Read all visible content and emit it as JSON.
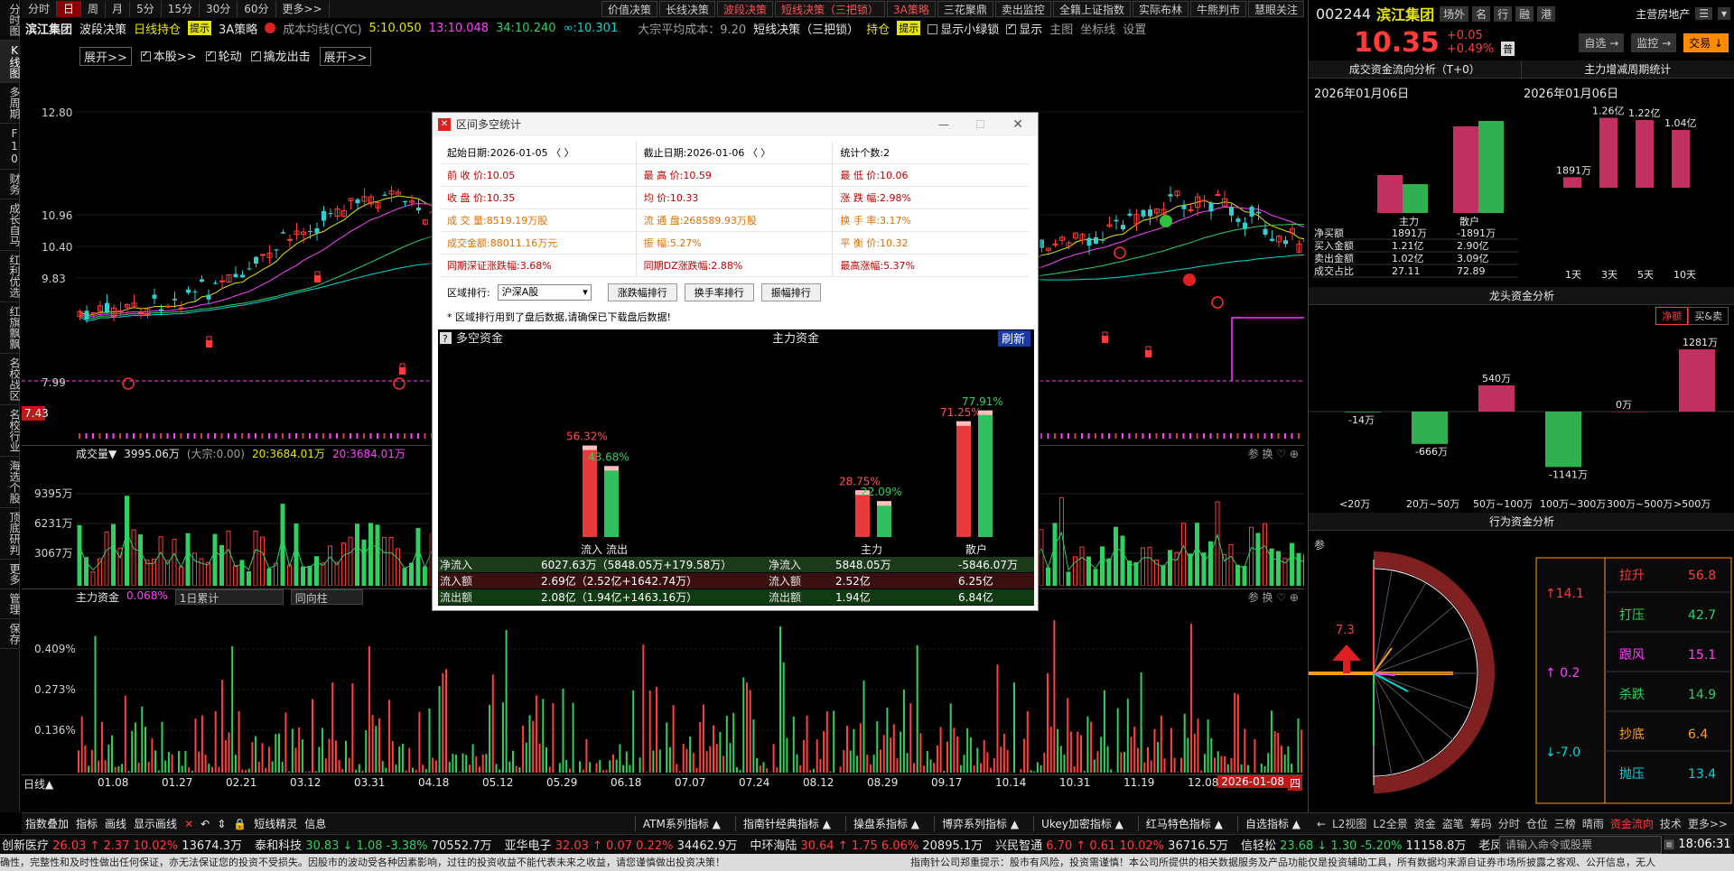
{
  "sidebar": [
    "分时图",
    "K线图",
    "多周期",
    "F10",
    "财务",
    "成长自马",
    "红利优选",
    "红旗飘飘",
    "名校战区",
    "名校行业",
    "海选个股",
    "顶底研判",
    "更多",
    "管理",
    "保存"
  ],
  "periods": [
    "分时",
    "日",
    "周",
    "月",
    "5分",
    "15分",
    "30分",
    "60分",
    "更多>>"
  ],
  "toolbar": [
    "价值决策",
    "长线决策",
    "波段决策",
    "短线决策（三把锁）",
    "3A策略",
    "三花聚鼎",
    "卖出监控",
    "全籍上证指数",
    "实际布林",
    "牛熊判市",
    "慧眼关注"
  ],
  "info": {
    "name": "滨江集团",
    "tag1": "波段决策",
    "tag2": "日线持仓",
    "tip": "提示",
    "strat": "3A策略",
    "cyc_label": "成本均线(CYC)",
    "cyc1": "5:10.050",
    "cyc2": "13:10.048",
    "cyc3": "34:10.240",
    "cyc4": "∞:10.301",
    "avg_cost": "大宗平均成本：9.20",
    "short": "短线决策（三把锁）",
    "hold": "持仓",
    "tip2": "提示",
    "show_green": "显示小绿锁",
    "show_more": "显示",
    "main_chart": "主图",
    "coord": "坐标线",
    "settings": "设置"
  },
  "sub": {
    "expand1": "展开>>",
    "this": "本股>>",
    "rotate": "轮动",
    "catch": "擒龙出击",
    "expand2": "展开>>"
  },
  "price_axis": {
    "p1": "12.80",
    "p2": "10.96",
    "p3": "10.40",
    "p4": "9.83",
    "p5": "7.99",
    "low": "7.43"
  },
  "vol": {
    "label": "成交量▼",
    "v": "3995.06万",
    "dz": "(大宗:0.00)",
    "ma20": "20:3684.01万",
    "ma20b": "20:3684.01万",
    "a1": "9395万",
    "a2": "6231万",
    "a3": "3067万"
  },
  "fund": {
    "label": "主力资金",
    "pct": "0.068%",
    "sel1": "1日累计",
    "sel2": "同向柱",
    "a1": "0.409%",
    "a2": "0.273%",
    "a3": "0.136%"
  },
  "panel_icons": "参 换 ♡ ⊕",
  "xaxis": {
    "label": "日线▲",
    "dates": [
      "01.08",
      "01.27",
      "02.21",
      "03.12",
      "03.31",
      "04.18",
      "05.12",
      "05.29",
      "06.18",
      "07.07",
      "07.24",
      "08.12",
      "08.29",
      "09.17",
      "10.14",
      "10.31",
      "11.19",
      "12.08"
    ],
    "cur": "2026-01-08",
    "cur_tag": "四"
  },
  "right": {
    "code": "002244",
    "name": "滨江集团",
    "tabs": [
      "场外",
      "名",
      "行",
      "融",
      "港"
    ],
    "sector": "主营房地产",
    "price": "10.35",
    "chg": "+0.05",
    "chgp": "+0.49%",
    "badge": "普",
    "btn_self": "自选 →",
    "btn_mon": "监控 →",
    "btn_trade": "交易 ↓",
    "flow_title": "成交资金流向分析（T+0）",
    "cycle_title": "主力增减周期统计",
    "date": "2026年01月06日",
    "flow_bars": {
      "main_label": "主力",
      "retail_label": "散户"
    },
    "flow_table": [
      [
        "净买额",
        "1891万",
        "-1891万"
      ],
      [
        "买入金额",
        "1.21亿",
        "2.90亿"
      ],
      [
        "卖出金额",
        "1.02亿",
        "3.09亿"
      ],
      [
        "成交占比",
        "27.11",
        "72.89"
      ]
    ],
    "cycle": {
      "labels": [
        "1天",
        "3天",
        "5天",
        "10天"
      ],
      "values": [
        "1891万",
        "1.26亿",
        "1.22亿",
        "1.04亿"
      ],
      "num": [
        0.19,
        1.26,
        1.22,
        1.04
      ]
    },
    "dragon_title": "龙头资金分析",
    "dragon_tabs": [
      "净额",
      "买&卖"
    ],
    "dragon": {
      "labels": [
        "<20万",
        "20万~50万",
        "50万~100万",
        "100万~300万",
        "300万~500万",
        ">500万"
      ],
      "values": [
        "-14万",
        "-666万",
        "540万",
        "-1141万",
        "0万",
        "1281万"
      ],
      "num": [
        -14,
        -666,
        540,
        -1141,
        0,
        1281
      ]
    },
    "behav_title": "行为资金分析",
    "behav_side": "参",
    "behav_arrow": "7.3",
    "behav_left": [
      {
        "v": "↑14.1",
        "c": "#ff3c3c"
      },
      {
        "v": "↑ 0.2",
        "c": "#ff40ff"
      },
      {
        "v": "↓-7.0",
        "c": "#00d8d8"
      }
    ],
    "behav_right": [
      {
        "k": "拉升",
        "v": "56.8",
        "c": "#ff3c3c"
      },
      {
        "k": "打压",
        "v": "42.7",
        "c": "#30d060"
      },
      {
        "k": "跟风",
        "v": "15.1",
        "c": "#ff40ff"
      },
      {
        "k": "杀跌",
        "v": "14.9",
        "c": "#30d060"
      },
      {
        "k": "抄底",
        "v": "6.4",
        "c": "#ff9a20"
      },
      {
        "k": "抛压",
        "v": "13.4",
        "c": "#00d8d8"
      }
    ],
    "bottom_tabs": [
      "←",
      "L2视图",
      "L2全景",
      "资金",
      "盗笔",
      "筹码",
      "分时",
      "仓位",
      "三榜",
      "晴雨",
      "资金流向",
      "技术",
      "更多>>"
    ]
  },
  "dialog": {
    "title": "区间多空统计",
    "rows": [
      [
        {
          "l": "起始日期:",
          "v": "2026-01-05  〈  〉",
          "c": "#000"
        },
        {
          "l": "截止日期:",
          "v": "2026-01-06  〈  〉",
          "c": "#000"
        },
        {
          "l": "统计个数:",
          "v": "2",
          "c": "#000"
        }
      ],
      [
        {
          "l": "前 收 价:",
          "v": "10.05",
          "c": "#c00000"
        },
        {
          "l": "最 高 价:",
          "v": "10.59",
          "c": "#c00000"
        },
        {
          "l": "最 低 价:",
          "v": "10.06",
          "c": "#c00000"
        }
      ],
      [
        {
          "l": "收 盘 价:",
          "v": "10.35",
          "c": "#c00000"
        },
        {
          "l": "均    价:",
          "v": "10.33",
          "c": "#c00000"
        },
        {
          "l": "涨 跌 幅:",
          "v": "2.98%",
          "c": "#c00000"
        }
      ],
      [
        {
          "l": "成 交 量:",
          "v": "8519.19万股",
          "c": "#e07000"
        },
        {
          "l": "流 通 盘:",
          "v": "268589.93万股",
          "c": "#e07000"
        },
        {
          "l": "换 手 率:",
          "v": "3.17%",
          "c": "#e07000"
        }
      ],
      [
        {
          "l": "成交金额:",
          "v": "88011.16万元",
          "c": "#e07000"
        },
        {
          "l": "振    幅:",
          "v": "5.27%",
          "c": "#e07000"
        },
        {
          "l": "平 衡 价:",
          "v": "10.32",
          "c": "#e07000"
        }
      ],
      [
        {
          "l": "同期深证涨跌幅:",
          "v": "3.68%",
          "c": "#c00000"
        },
        {
          "l": "同期DZ涨跌幅:",
          "v": "2.88%",
          "c": "#c00000"
        },
        {
          "l": "最高涨幅:",
          "v": "5.37%",
          "c": "#c00000"
        }
      ]
    ],
    "rank_label": "区域排行:",
    "rank_sel": "沪深A股",
    "rank_btns": [
      "涨跌幅排行",
      "换手率排行",
      "振幅排行"
    ],
    "note": "* 区域排行用到了盘后数据,请确保已下载盘后数据!",
    "chart_left_title": "多空资金",
    "chart_mid_title": "主力资金",
    "refresh": "刷新",
    "bars": {
      "in": "56.32%",
      "out": "43.68%",
      "main_in": "28.75%",
      "main_out": "22.09%",
      "retail_in": "71.25%",
      "retail_out": "77.91%"
    },
    "bar_labels": {
      "in": "流入",
      "out": "流出",
      "main": "主力",
      "retail": "散户"
    },
    "table": [
      {
        "k": "净流入",
        "v": "6027.63万（5848.05万+179.58万）",
        "k2": "净流入",
        "v2": "5848.05万",
        "v3": "-5846.07万",
        "bg": "#1a3a1a"
      },
      {
        "k": "流入额",
        "v": "2.69亿（2.52亿+1642.74万）",
        "k2": "流入额",
        "v2": "2.52亿",
        "v3": "6.25亿",
        "bg": "#3a1010"
      },
      {
        "k": "流出额",
        "v": "2.08亿（1.94亿+1463.16万）",
        "k2": "流出额",
        "v2": "1.94亿",
        "v3": "6.84亿",
        "bg": "#103a10"
      }
    ]
  },
  "bottom_tools": [
    "指数叠加",
    "指标",
    "画线",
    "显示画线",
    "✕",
    "↶",
    "⇕",
    "🔒",
    "短线精灵",
    "信息"
  ],
  "bottom_menus": [
    "ATM系列指标 ▲",
    "指南针经典指标 ▲",
    "操盘系指标 ▲",
    "博弈系列指标 ▲",
    "Ukey加密指标 ▲",
    "红马特色指标 ▲",
    "自选指标 ▲"
  ],
  "ticker": [
    {
      "n": "创新医疗",
      "v": "26.03 ↑ 2.37 10.02%",
      "a": "13674.3万",
      "up": true
    },
    {
      "n": "泰和科技",
      "v": "30.83 ↓ 1.08 -3.38%",
      "a": "70552.7万",
      "up": false
    },
    {
      "n": "亚华电子",
      "v": "32.03 ↑ 0.07 0.22%",
      "a": "34462.9万",
      "up": true
    },
    {
      "n": "中环海陆",
      "v": "30.64 ↑ 1.75 6.06%",
      "a": "20895.1万",
      "up": true
    },
    {
      "n": "兴民智通",
      "v": "6.70 ↑ 0.61 10.02%",
      "a": "36716.5万",
      "up": true
    },
    {
      "n": "信轻松",
      "v": "23.68 ↓ 1.30 -5.20%",
      "a": "11158.8万",
      "up": false
    },
    {
      "n": "老凤",
      "v": "",
      "a": "",
      "up": true
    }
  ],
  "cmd_placeholder": "请输入命令或股票",
  "clock": "18:06:31",
  "disclaimer": "确性，完整性和及时性做出任何保证，亦无法保证您的投资不受损失。因股市的波动受各种因素影响，过往的投资收益不能代表未来之收益，请您谨慎做出投资决策！",
  "disclaimer2": "指南针公司郑重提示：股市有风险，投资需谨慎！本公司所提供的相关数据服务及产品功能仅是投资辅助工具，所有数据均来源自证券市场所披露之客观、公开信息，无人"
}
